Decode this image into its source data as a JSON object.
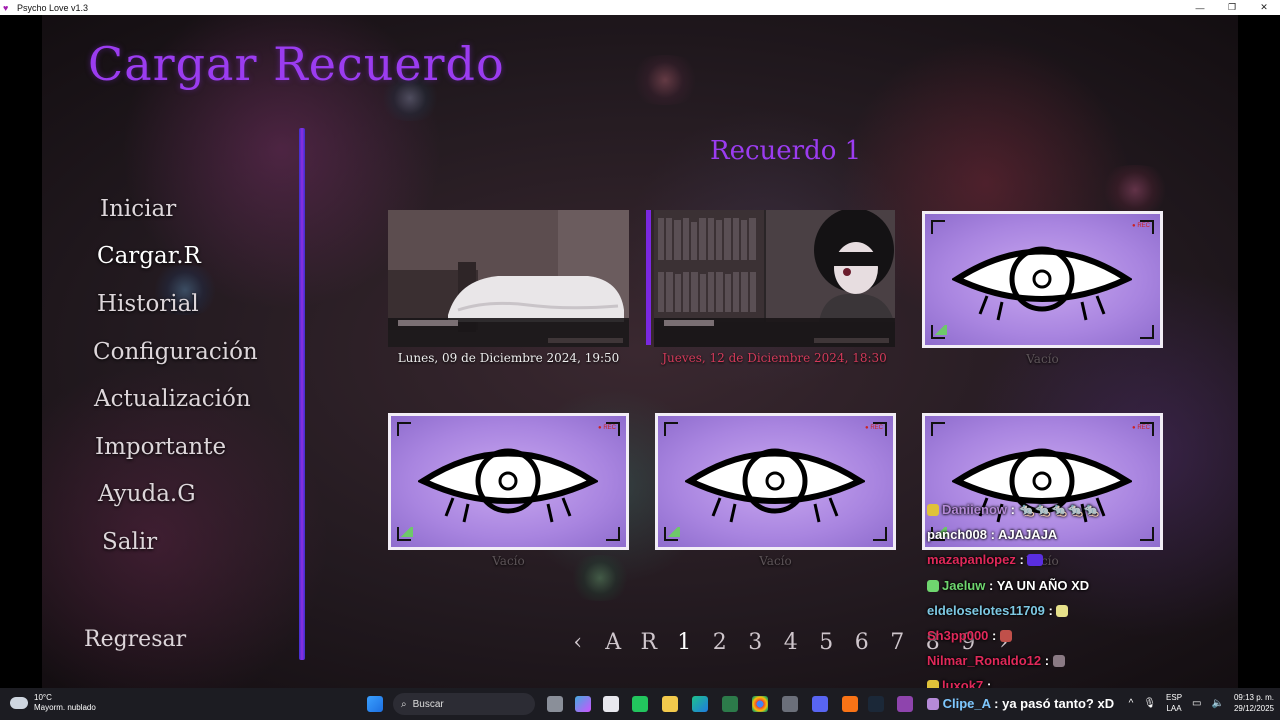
{
  "window": {
    "title": "Psycho Love v1.3",
    "controls": [
      "—",
      "❐",
      "✕"
    ]
  },
  "screen": {
    "title": "Cargar Recuerdo",
    "slot_page_title": "Recuerdo 1"
  },
  "menu": {
    "items": [
      {
        "label": "Iniciar"
      },
      {
        "label": "Cargar.R",
        "active": true
      },
      {
        "label": "Historial"
      },
      {
        "label": "Configuración"
      },
      {
        "label": "Actualización"
      },
      {
        "label": "Importante"
      },
      {
        "label": "Ayuda.G"
      },
      {
        "label": "Salir"
      }
    ],
    "back": "Regresar"
  },
  "slots": [
    {
      "caption": "Lunes, 09 de Diciembre 2024, 19:50",
      "state": "saved",
      "scene": "bedroom"
    },
    {
      "caption": "Jueves, 12 de Diciembre 2024, 18:30",
      "state": "saved-hover",
      "scene": "library"
    },
    {
      "caption": "Vacío",
      "state": "empty"
    },
    {
      "caption": "Vacío",
      "state": "empty"
    },
    {
      "caption": "Vacío",
      "state": "empty"
    },
    {
      "caption": "Vacío",
      "state": "empty"
    }
  ],
  "pagination": {
    "prev": "‹",
    "auto": "A",
    "recent": "R",
    "pages": [
      "1",
      "2",
      "3",
      "4",
      "5",
      "6",
      "7",
      "8",
      "9"
    ],
    "current": "1",
    "next": "›"
  },
  "chat": [
    {
      "user": "Daniienow",
      "text": ": 🐀🐀🐀🐀🐀",
      "color": "#b58ad8"
    },
    {
      "user": "panch008",
      "text": ": AJAJAJA",
      "color": "#ffffff"
    },
    {
      "user": "mazapanlopez",
      "text": ":",
      "color": "#e0295a"
    },
    {
      "user": "Jaeluw",
      "text": ": YA UN AÑO XD",
      "color": "#6fd66f"
    },
    {
      "user": "eldeloselotes11709",
      "text": ":",
      "color": "#7ec8e3"
    },
    {
      "user": "Sh3pp000",
      "text": ":",
      "color": "#e0295a"
    },
    {
      "user": "Nilmar_Ronaldo12",
      "text": ":",
      "color": "#e0295a"
    },
    {
      "user": "luxok7",
      "text": ":",
      "color": "#e0295a"
    },
    {
      "user": "Clipe_A",
      "text": ": ya pasó tanto? xD",
      "color": "#7ec8ff"
    }
  ],
  "taskbar": {
    "weather_temp": "10°C",
    "weather_desc": "Mayorm. nublado",
    "search_placeholder": "Buscar",
    "lang_top": "ESP",
    "lang_bottom": "LAA",
    "time": "09:13 p. m.",
    "date": "29/12/2025"
  },
  "colors": {
    "accent": "#9b3cf0",
    "divider": "#6a2ee0",
    "hover_caption": "#d33a5a",
    "empty_slot": "#b898ea"
  }
}
